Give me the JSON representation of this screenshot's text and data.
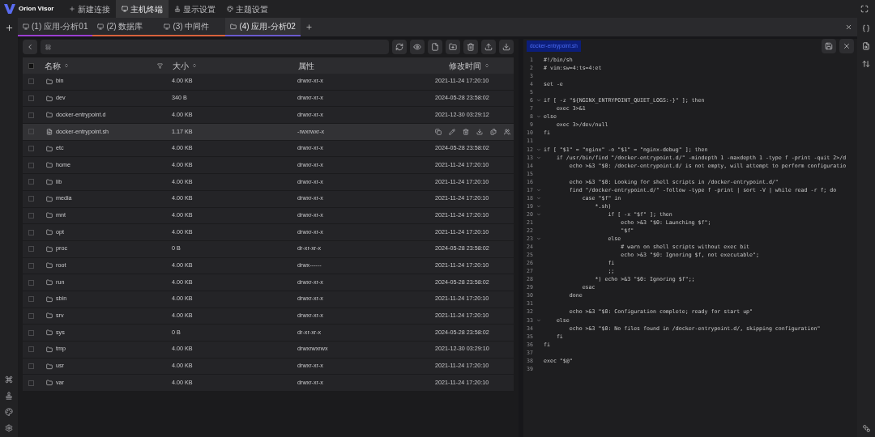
{
  "app": {
    "name": "Orion Visor"
  },
  "menu": [
    {
      "label": "新建连接",
      "kind": "plus",
      "selected": false
    },
    {
      "label": "主机终端",
      "kind": "monitor",
      "selected": true
    },
    {
      "label": "显示设置",
      "kind": "stamp",
      "selected": false
    },
    {
      "label": "主题设置",
      "kind": "palette",
      "selected": false
    }
  ],
  "session_tabs": [
    {
      "label": "(1) 应用-分析01",
      "kind": "terminal",
      "color": "#9b3fd0",
      "selected": false
    },
    {
      "label": "(2) 数据库",
      "kind": "terminal",
      "color": "#d8623c",
      "selected": false
    },
    {
      "label": "(3) 中间件",
      "kind": "terminal",
      "color": "#d8623c",
      "selected": false
    },
    {
      "label": "(4) 应用-分析02",
      "kind": "sftp",
      "color": "#6a5acd",
      "selected": true
    }
  ],
  "table": {
    "select_all": {
      "checked": false
    },
    "columns": [
      "名称",
      "大小",
      "属性",
      "修改时间"
    ],
    "rows": [
      {
        "name": "bin",
        "size": "4.00 KB",
        "attr": "drwxr-xr-x",
        "time": "2021-11-24 17:20:10",
        "kind": "folder",
        "selected": false
      },
      {
        "name": "dev",
        "size": "340 B",
        "attr": "drwxr-xr-x",
        "time": "2024-05-28 23:58:02",
        "kind": "folder",
        "selected": false
      },
      {
        "name": "docker-entrypoint.d",
        "size": "4.00 KB",
        "attr": "drwxr-xr-x",
        "time": "2021-12-30 03:29:12",
        "kind": "folder",
        "selected": false
      },
      {
        "name": "docker-entrypoint.sh",
        "size": "1.17 KB",
        "attr": "-rwxrwxr-x",
        "kind": "file",
        "selected": true
      },
      {
        "name": "etc",
        "size": "4.00 KB",
        "attr": "drwxr-xr-x",
        "time": "2024-05-28 23:58:02",
        "kind": "folder",
        "selected": false
      },
      {
        "name": "home",
        "size": "4.00 KB",
        "attr": "drwxr-xr-x",
        "time": "2021-11-24 17:20:10",
        "kind": "folder",
        "selected": false
      },
      {
        "name": "lib",
        "size": "4.00 KB",
        "attr": "drwxr-xr-x",
        "time": "2021-11-24 17:20:10",
        "kind": "folder",
        "selected": false
      },
      {
        "name": "media",
        "size": "4.00 KB",
        "attr": "drwxr-xr-x",
        "time": "2021-11-24 17:20:10",
        "kind": "folder",
        "selected": false
      },
      {
        "name": "mnt",
        "size": "4.00 KB",
        "attr": "drwxr-xr-x",
        "time": "2021-11-24 17:20:10",
        "kind": "folder",
        "selected": false
      },
      {
        "name": "opt",
        "size": "4.00 KB",
        "attr": "drwxr-xr-x",
        "time": "2021-11-24 17:20:10",
        "kind": "folder",
        "selected": false
      },
      {
        "name": "proc",
        "size": "0 B",
        "attr": "dr-xr-xr-x",
        "time": "2024-05-28 23:58:02",
        "kind": "folder",
        "selected": false
      },
      {
        "name": "root",
        "size": "4.00 KB",
        "attr": "drwx------",
        "time": "2021-11-24 17:20:10",
        "kind": "folder",
        "selected": false
      },
      {
        "name": "run",
        "size": "4.00 KB",
        "attr": "drwxr-xr-x",
        "time": "2024-05-28 23:58:02",
        "kind": "folder",
        "selected": false
      },
      {
        "name": "sbin",
        "size": "4.00 KB",
        "attr": "drwxr-xr-x",
        "time": "2021-11-24 17:20:10",
        "kind": "folder",
        "selected": false
      },
      {
        "name": "srv",
        "size": "4.00 KB",
        "attr": "drwxr-xr-x",
        "time": "2021-11-24 17:20:10",
        "kind": "folder",
        "selected": false
      },
      {
        "name": "sys",
        "size": "0 B",
        "attr": "dr-xr-xr-x",
        "time": "2024-05-28 23:58:02",
        "kind": "folder",
        "selected": false
      },
      {
        "name": "tmp",
        "size": "4.00 KB",
        "attr": "drwxrwxrwx",
        "time": "2021-12-30 03:29:10",
        "kind": "folder",
        "selected": false
      },
      {
        "name": "usr",
        "size": "4.00 KB",
        "attr": "drwxr-xr-x",
        "time": "2021-11-24 17:20:10",
        "kind": "folder",
        "selected": false
      },
      {
        "name": "var",
        "size": "4.00 KB",
        "attr": "drwxr-xr-x",
        "time": "2021-11-24 17:20:10",
        "kind": "folder",
        "selected": false
      }
    ]
  },
  "editor": {
    "file_tab": "docker-entrypoint.sh",
    "lines": [
      {
        "no": "1",
        "text": "#!/bin/sh",
        "fold": false
      },
      {
        "no": "2",
        "text": "# vim:sw=4:ts=4:et",
        "fold": false
      },
      {
        "no": "3",
        "fold": false
      },
      {
        "no": "4",
        "text": "set -e",
        "fold": false
      },
      {
        "no": "5",
        "fold": false
      },
      {
        "no": "6",
        "text": "if [ -z \"${NGINX_ENTRYPOINT_QUIET_LOGS:-}\" ]; then",
        "fold": true
      },
      {
        "no": "7",
        "text": "    exec 3>&1",
        "fold": false
      },
      {
        "no": "8",
        "text": "else",
        "fold": true
      },
      {
        "no": "9",
        "text": "    exec 3>/dev/null",
        "fold": false
      },
      {
        "no": "10",
        "text": "fi",
        "fold": false
      },
      {
        "no": "11",
        "fold": false
      },
      {
        "no": "12",
        "text": "if [ \"$1\" = \"nginx\" -o \"$1\" = \"nginx-debug\" ]; then",
        "fold": true
      },
      {
        "no": "13",
        "text": "    if /usr/bin/find \"/docker-entrypoint.d/\" -mindepth 1 -maxdepth 1 -type f -print -quit 2>/d",
        "fold": true
      },
      {
        "no": "14",
        "text": "        echo >&3 \"$0: /docker-entrypoint.d/ is not empty, will attempt to perform configuratio",
        "fold": false
      },
      {
        "no": "15",
        "fold": false
      },
      {
        "no": "16",
        "text": "        echo >&3 \"$0: Looking for shell scripts in /docker-entrypoint.d/\"",
        "fold": false
      },
      {
        "no": "17",
        "text": "        find \"/docker-entrypoint.d/\" -follow -type f -print | sort -V | while read -r f; do",
        "fold": true
      },
      {
        "no": "18",
        "text": "            case \"$f\" in",
        "fold": true
      },
      {
        "no": "19",
        "text": "                *.sh)",
        "fold": true
      },
      {
        "no": "20",
        "text": "                    if [ -x \"$f\" ]; then",
        "fold": true
      },
      {
        "no": "21",
        "text": "                        echo >&3 \"$0: Launching $f\";",
        "fold": false
      },
      {
        "no": "22",
        "text": "                        \"$f\"",
        "fold": false
      },
      {
        "no": "23",
        "text": "                    else",
        "fold": true
      },
      {
        "no": "24",
        "text": "                        # warn on shell scripts without exec bit",
        "fold": false
      },
      {
        "no": "25",
        "text": "                        echo >&3 \"$0: Ignoring $f, not executable\";",
        "fold": false
      },
      {
        "no": "26",
        "text": "                    fi",
        "fold": false
      },
      {
        "no": "27",
        "text": "                    ;;",
        "fold": false
      },
      {
        "no": "28",
        "text": "                *) echo >&3 \"$0: Ignoring $f\";;",
        "fold": false
      },
      {
        "no": "29",
        "text": "            esac",
        "fold": false
      },
      {
        "no": "30",
        "text": "        done",
        "fold": false
      },
      {
        "no": "31",
        "fold": false
      },
      {
        "no": "32",
        "text": "        echo >&3 \"$0: Configuration complete; ready for start up\"",
        "fold": false
      },
      {
        "no": "33",
        "text": "    else",
        "fold": true
      },
      {
        "no": "34",
        "text": "        echo >&3 \"$0: No files found in /docker-entrypoint.d/, skipping configuration\"",
        "fold": false
      },
      {
        "no": "35",
        "text": "    fi",
        "fold": false
      },
      {
        "no": "36",
        "text": "fi",
        "fold": false
      },
      {
        "no": "37",
        "fold": false
      },
      {
        "no": "38",
        "text": "exec \"$@\"",
        "fold": false
      },
      {
        "no": "39",
        "fold": false
      }
    ]
  }
}
